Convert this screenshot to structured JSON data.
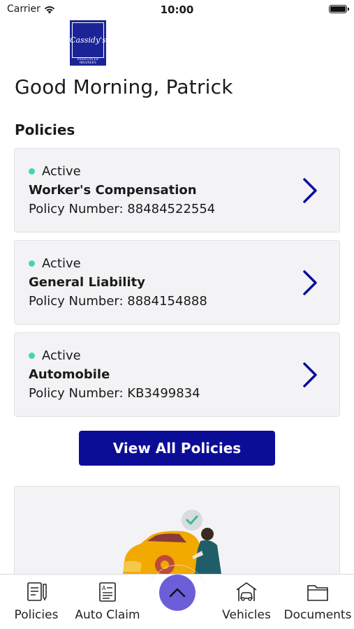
{
  "status_bar": {
    "carrier": "Carrier",
    "time": "10:00"
  },
  "logo": {
    "name": "Cassidy's",
    "subtitle": "ASSOCIATED INSURERS"
  },
  "greeting": "Good Morning, Patrick",
  "section_title": "Policies",
  "policies": [
    {
      "status": "Active",
      "name": "Worker's Compensation",
      "number": "Policy Number: 88484522554"
    },
    {
      "status": "Active",
      "name": "General Liability",
      "number": "Policy Number: 8884154888"
    },
    {
      "status": "Active",
      "name": "Automobile",
      "number": "Policy Number: KB3499834"
    }
  ],
  "view_all_label": "View All Policies",
  "tabs": {
    "policies": "Policies",
    "auto_claim": "Auto Claim",
    "vehicles": "Vehicles",
    "documents": "Documents"
  },
  "icons": {
    "center": "chevron-up-icon",
    "policies": "document-pen-icon",
    "auto_claim": "claim-form-icon",
    "vehicles": "garage-car-icon",
    "documents": "folder-icon"
  },
  "colors": {
    "primary": "#0c0d97",
    "accent_fab": "#6b5ed8",
    "active_dot": "#40d6b4",
    "card_bg": "#f3f3f5"
  }
}
